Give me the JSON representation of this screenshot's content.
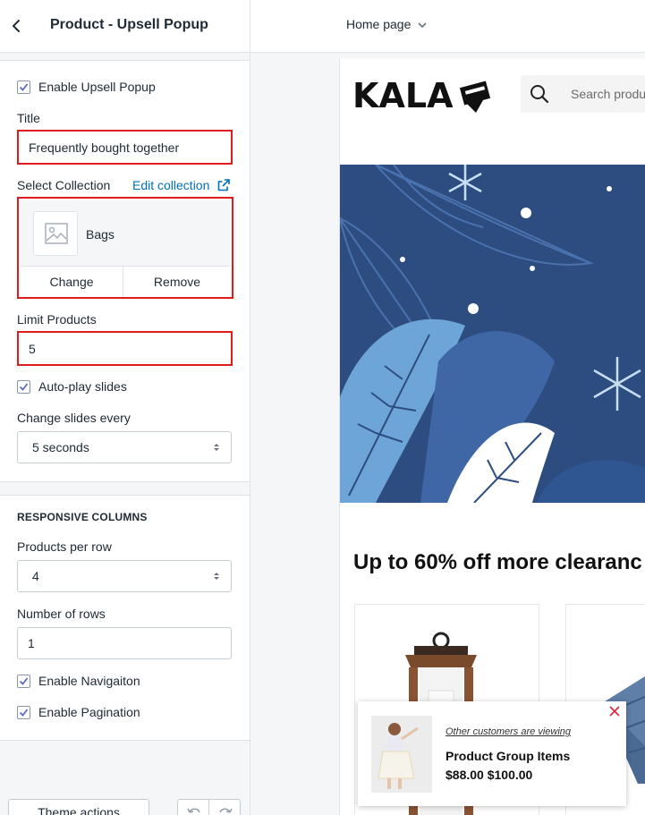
{
  "sidebar": {
    "title": "Product - Upsell Popup",
    "enable_popup": {
      "label": "Enable Upsell Popup",
      "checked": true
    },
    "title_field": {
      "label": "Title",
      "value": "Frequently bought together"
    },
    "collection": {
      "label": "Select Collection",
      "edit_link": "Edit collection",
      "name": "Bags",
      "change": "Change",
      "remove": "Remove"
    },
    "limit": {
      "label": "Limit Products",
      "value": "5"
    },
    "autoplay": {
      "label": "Auto-play slides",
      "checked": true
    },
    "change_every": {
      "label": "Change slides every",
      "value": "5 seconds"
    },
    "responsive": {
      "title": "RESPONSIVE COLUMNS",
      "per_row": {
        "label": "Products per row",
        "value": "4"
      },
      "rows": {
        "label": "Number of rows",
        "value": "1"
      },
      "navigation": {
        "label": "Enable Navigaiton",
        "checked": true
      },
      "pagination": {
        "label": "Enable Pagination",
        "checked": true
      }
    },
    "footer": {
      "theme_actions": "Theme actions"
    }
  },
  "topbar": {
    "page": "Home page"
  },
  "preview": {
    "logo": "KALA",
    "search_placeholder": "Search produ",
    "heading": "Up to 60% off more clearanc",
    "popup": {
      "viewing": "Other customers are viewing",
      "title": "Product Group Items",
      "price": "$88.00",
      "compare_price": "$100.00"
    }
  },
  "colors": {
    "accent": "#006fbb",
    "highlight": "#e01b1b",
    "hero": "#2d4d80",
    "checkbox": "#5c6ac4"
  }
}
